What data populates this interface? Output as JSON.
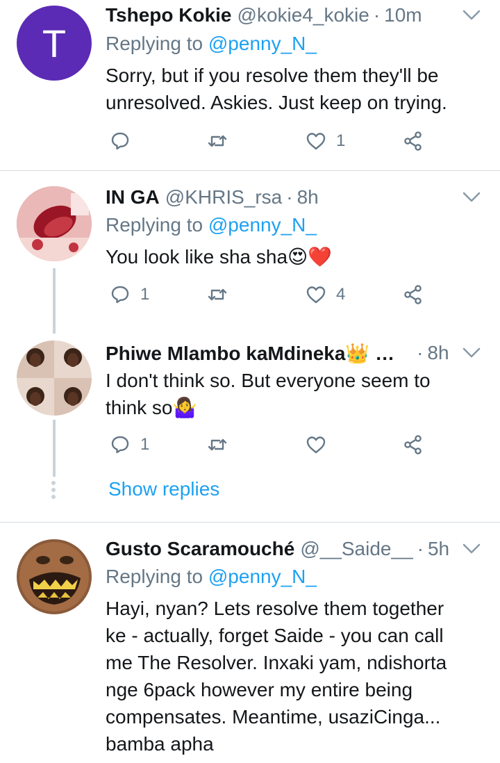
{
  "tweets": [
    {
      "name": "Tshepo Kokie",
      "handle": "@kokie4_kokie",
      "time": "10m",
      "avatar_letter": "T",
      "replying_label": "Replying to ",
      "replying_handle": "@penny_N_",
      "text": "Sorry, but if you resolve them they'll be unresolved. Askies. Just keep on trying.",
      "reply_count": "",
      "retweet_count": "",
      "like_count": "1"
    },
    {
      "name": "IN GA",
      "handle": "@KHRIS_rsa",
      "time": "8h",
      "replying_label": "Replying to ",
      "replying_handle": "@penny_N_",
      "text": "You look like sha sha😍❤️",
      "reply_count": "1",
      "retweet_count": "",
      "like_count": "4"
    },
    {
      "name": "Phiwe Mlambo kaMdineka👑 …",
      "handle": "",
      "time": "8h",
      "text": "I don't think so. But everyone seem to think so🤷‍♀️",
      "reply_count": "1",
      "retweet_count": "",
      "like_count": "",
      "show_replies": "Show replies"
    },
    {
      "name": "Gusto Scaramouché",
      "handle": "@__Saide__",
      "time": "5h",
      "replying_label": "Replying to ",
      "replying_handle": "@penny_N_",
      "text_lines": [
        "Hayi, nyan? Lets resolve them together",
        "ke - actually, forget Saide - you can call",
        "me The Resolver. Inxaki yam, ndishorta",
        "nge 6pack however my entire being",
        "compensates.  Meantime, usaziCinga...",
        "bamba apha"
      ]
    }
  ],
  "separator": "·",
  "colors": {
    "link": "#1da1f2",
    "secondary_text": "#657786",
    "divider": "#d7dde2",
    "avatar_purple": "#5b2bb5"
  }
}
